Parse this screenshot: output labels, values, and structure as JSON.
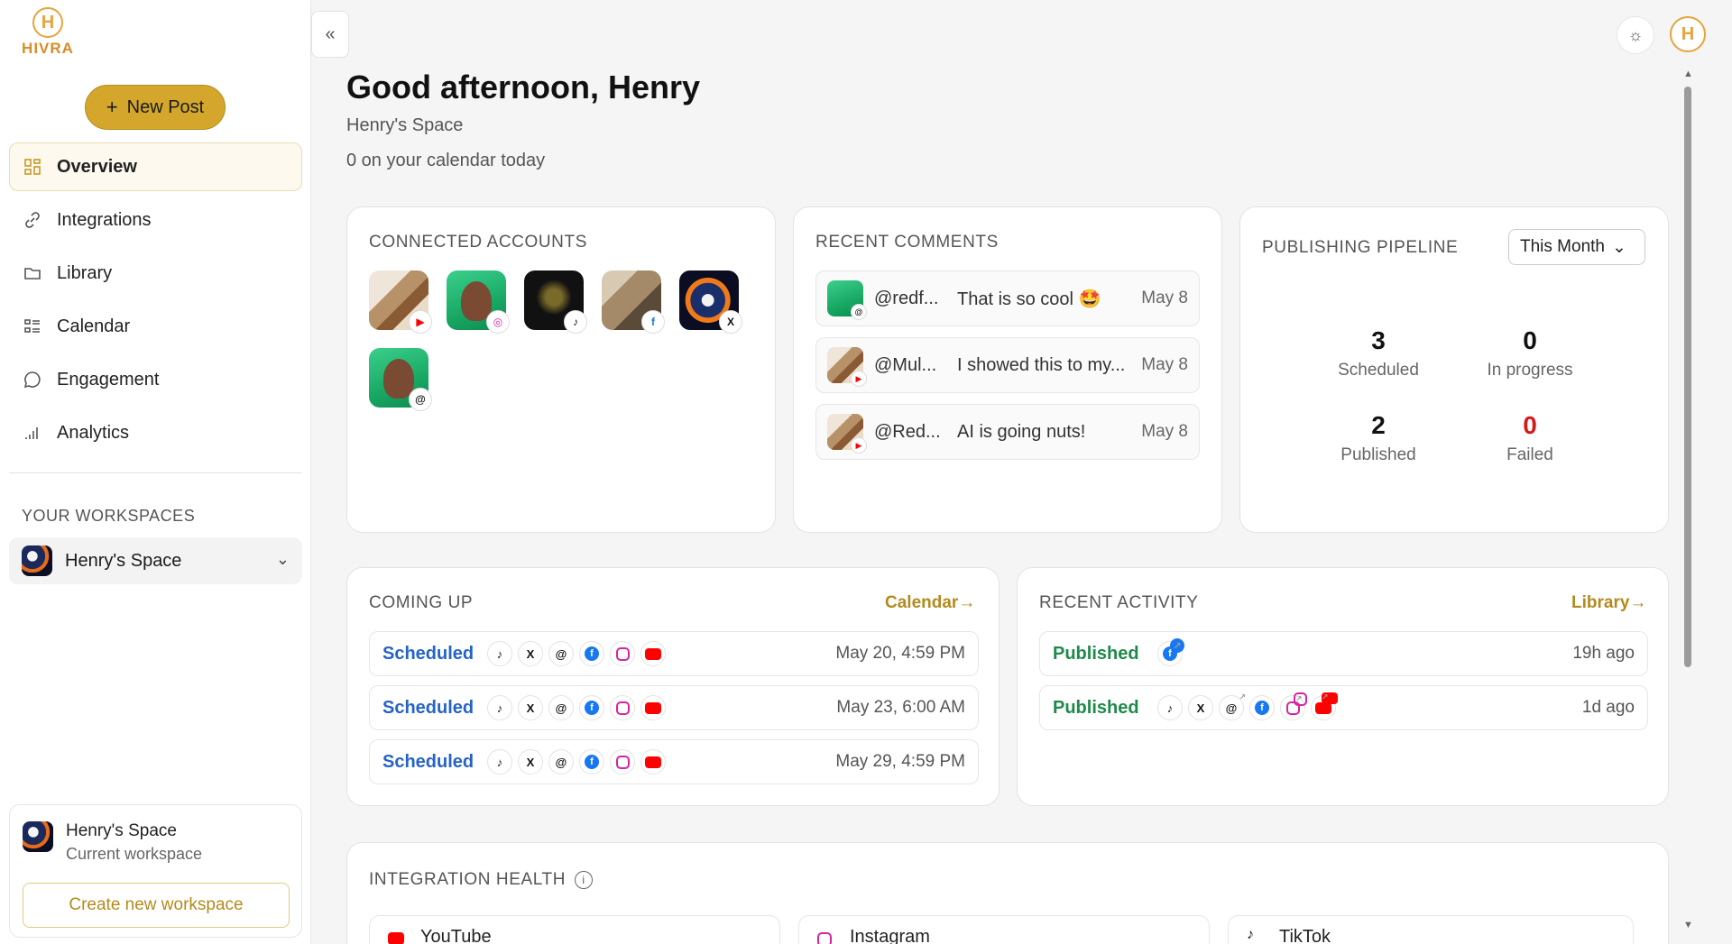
{
  "brand": {
    "name": "HIVRA",
    "mark": "H"
  },
  "sidebar": {
    "new_post_label": "New Post",
    "items": [
      {
        "label": "Overview",
        "icon": "grid-icon",
        "active": true
      },
      {
        "label": "Integrations",
        "icon": "link-icon"
      },
      {
        "label": "Library",
        "icon": "folder-icon"
      },
      {
        "label": "Calendar",
        "icon": "calendar-list-icon"
      },
      {
        "label": "Engagement",
        "icon": "chat-bubble-icon"
      },
      {
        "label": "Analytics",
        "icon": "bar-chart-icon"
      }
    ],
    "workspaces_heading": "YOUR WORKSPACES",
    "workspace_selected": "Henry's Space",
    "current_card": {
      "name": "Henry's Space",
      "subtitle": "Current workspace",
      "create_label": "Create new workspace"
    }
  },
  "header": {
    "greeting": "Good afternoon, Henry",
    "space": "Henry's Space",
    "calendar_today": "0 on your calendar today"
  },
  "connected_accounts": {
    "title": "CONNECTED ACCOUNTS",
    "accounts": [
      {
        "platform": "youtube",
        "badge": "▶"
      },
      {
        "platform": "instagram",
        "badge": "◎"
      },
      {
        "platform": "tiktok",
        "badge": "♪"
      },
      {
        "platform": "facebook",
        "badge": "f"
      },
      {
        "platform": "x",
        "badge": "X"
      },
      {
        "platform": "threads",
        "badge": "@"
      }
    ]
  },
  "recent_comments": {
    "title": "RECENT COMMENTS",
    "items": [
      {
        "user": "@redf...",
        "text": "That is so cool 🤩",
        "date": "May 8",
        "badge": "@"
      },
      {
        "user": "@Mul...",
        "text": "I showed this to my...",
        "date": "May 8",
        "badge": "▶"
      },
      {
        "user": "@Red...",
        "text": "AI is going nuts!",
        "date": "May 8",
        "badge": "▶"
      }
    ]
  },
  "pipeline": {
    "title": "PUBLISHING PIPELINE",
    "range": "This Month",
    "stats": [
      {
        "value": "3",
        "label": "Scheduled"
      },
      {
        "value": "0",
        "label": "In progress"
      },
      {
        "value": "2",
        "label": "Published"
      },
      {
        "value": "0",
        "label": "Failed"
      }
    ],
    "failed_color": "#d11a1a"
  },
  "coming_up": {
    "title": "COMING UP",
    "link": "Calendar",
    "rows": [
      {
        "status": "Scheduled",
        "time": "May 20, 4:59 PM"
      },
      {
        "status": "Scheduled",
        "time": "May 23, 6:00 AM"
      },
      {
        "status": "Scheduled",
        "time": "May 29, 4:59 PM"
      }
    ]
  },
  "recent_activity": {
    "title": "RECENT ACTIVITY",
    "link": "Library",
    "rows": [
      {
        "status": "Published",
        "time": "19h ago"
      },
      {
        "status": "Published",
        "time": "1d ago"
      }
    ]
  },
  "integration_health": {
    "title": "INTEGRATION HEALTH",
    "items": [
      "YouTube",
      "Instagram",
      "TikTok"
    ]
  },
  "glyphs": {
    "plus": "+",
    "arrow": "→",
    "chevron_down": "⌄",
    "collapse": "«",
    "sun": "☼",
    "info": "i",
    "tiktok": "♪",
    "x": "X",
    "threads": "@",
    "facebook": "f",
    "up": "▲",
    "down": "▼",
    "ext": "↗"
  },
  "colors": {
    "accent": "#d4a72c",
    "scheduled": "#2563c9",
    "published": "#1e8a4a"
  }
}
